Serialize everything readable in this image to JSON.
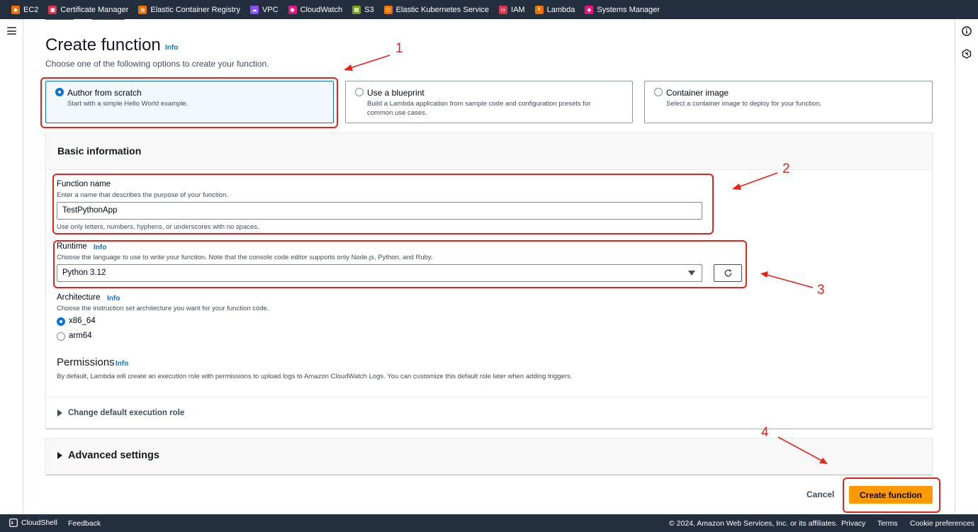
{
  "favorites": [
    {
      "label": "EC2",
      "color": "#ed7100",
      "icon": "ec2-icon"
    },
    {
      "label": "Certificate Manager",
      "color": "#dd344c",
      "icon": "certificate-manager-icon"
    },
    {
      "label": "Elastic Container Registry",
      "color": "#ed7100",
      "icon": "ecr-icon"
    },
    {
      "label": "VPC",
      "color": "#8c4fff",
      "icon": "vpc-icon"
    },
    {
      "label": "CloudWatch",
      "color": "#e7157b",
      "icon": "cloudwatch-icon"
    },
    {
      "label": "S3",
      "color": "#7aa116",
      "icon": "s3-icon"
    },
    {
      "label": "Elastic Kubernetes Service",
      "color": "#ed7100",
      "icon": "eks-icon"
    },
    {
      "label": "IAM",
      "color": "#dd344c",
      "icon": "iam-icon"
    },
    {
      "label": "Lambda",
      "color": "#ed7100",
      "icon": "lambda-icon"
    },
    {
      "label": "Systems Manager",
      "color": "#e7157b",
      "icon": "systems-manager-icon"
    }
  ],
  "page": {
    "title": "Create function",
    "info": "Info",
    "subtitle": "Choose one of the following options to create your function."
  },
  "options": [
    {
      "title": "Author from scratch",
      "desc": "Start with a simple Hello World example.",
      "selected": true
    },
    {
      "title": "Use a blueprint",
      "desc": "Build a Lambda application from sample code and configuration presets for common use cases.",
      "selected": false
    },
    {
      "title": "Container image",
      "desc": "Select a container image to deploy for your function.",
      "selected": false
    }
  ],
  "basic": {
    "heading": "Basic information",
    "function_name": {
      "label": "Function name",
      "desc": "Enter a name that describes the purpose of your function.",
      "value": "TestPythonApp",
      "constraint": "Use only letters, numbers, hyphens, or underscores with no spaces."
    },
    "runtime": {
      "label": "Runtime",
      "info": "Info",
      "desc": "Choose the language to use to write your function. Note that the console code editor supports only Node.js, Python, and Ruby.",
      "value": "Python 3.12"
    },
    "architecture": {
      "label": "Architecture",
      "info": "Info",
      "desc": "Choose the instruction set architecture you want for your function code.",
      "options": [
        "x86_64",
        "arm64"
      ],
      "selected": "x86_64"
    },
    "permissions": {
      "label": "Permissions",
      "info": "Info",
      "desc": "By default, Lambda will create an execution role with permissions to upload logs to Amazon CloudWatch Logs. You can customize this default role later when adding triggers."
    },
    "change_role": "Change default execution role"
  },
  "advanced": "Advanced settings",
  "actions": {
    "cancel": "Cancel",
    "create": "Create function"
  },
  "annotations": [
    "1",
    "2",
    "3",
    "4"
  ],
  "annotation_color": "#e8231b",
  "footer": {
    "cloudshell": "CloudShell",
    "feedback": "Feedback",
    "copyright": "© 2024, Amazon Web Services, Inc. or its affiliates.",
    "privacy": "Privacy",
    "terms": "Terms",
    "cookies": "Cookie preferences"
  }
}
